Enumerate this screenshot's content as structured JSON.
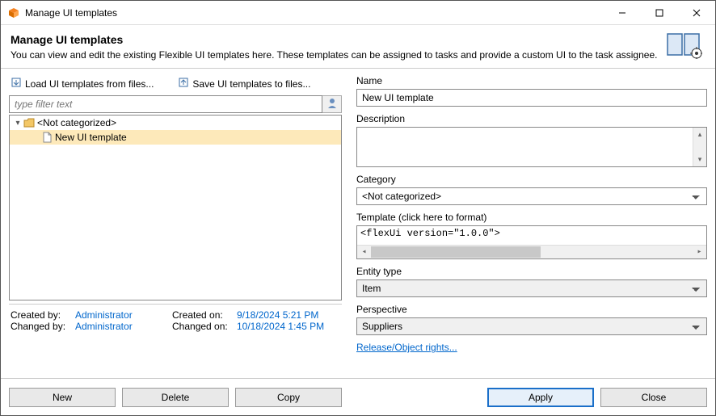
{
  "titlebar": {
    "title": "Manage UI templates"
  },
  "header": {
    "title": "Manage UI templates",
    "subtitle": "You can view and edit the existing Flexible UI templates here. These templates can be assigned to tasks and provide a custom UI to the task assignee."
  },
  "left": {
    "load_link": "Load UI templates from files...",
    "save_link": "Save UI templates to files...",
    "filter_placeholder": "type filter text",
    "tree": {
      "root_label": "<Not categorized>",
      "item_label": "New UI template"
    },
    "meta": {
      "created_by_lbl": "Created by:",
      "created_by_val": "Administrator",
      "changed_by_lbl": "Changed by:",
      "changed_by_val": "Administrator",
      "created_on_lbl": "Created on:",
      "created_on_val": "9/18/2024 5:21 PM",
      "changed_on_lbl": "Changed on:",
      "changed_on_val": "10/18/2024 1:45 PM"
    }
  },
  "right": {
    "name_lbl": "Name",
    "name_val": "New UI template",
    "desc_lbl": "Description",
    "cat_lbl": "Category",
    "cat_val": "<Not categorized>",
    "tmpl_lbl_pre": "Template (click ",
    "tmpl_lbl_link": "here",
    "tmpl_lbl_post": " to format)",
    "tmpl_code": "<flexUi version=\"1.0.0\">",
    "entity_lbl": "Entity type",
    "entity_val": "Item",
    "persp_lbl": "Perspective",
    "persp_val": "Suppliers",
    "rights_link": "Release/Object rights..."
  },
  "footer": {
    "new_btn": "New",
    "delete_btn": "Delete",
    "copy_btn": "Copy",
    "apply_btn": "Apply",
    "close_btn": "Close"
  }
}
